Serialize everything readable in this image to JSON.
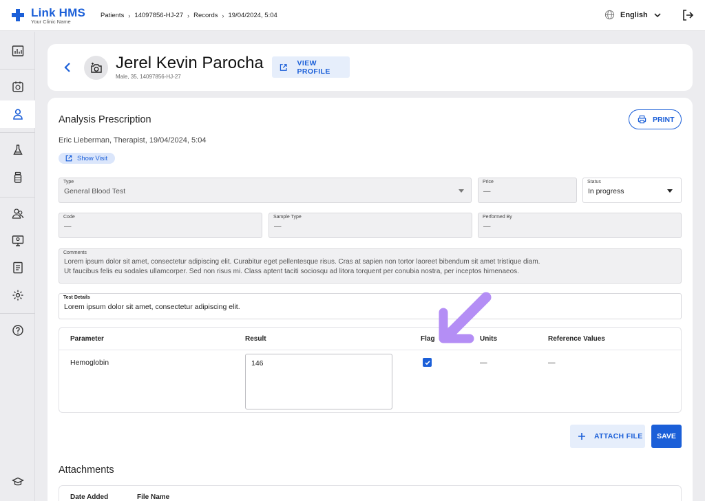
{
  "app": {
    "name": "Link HMS",
    "tagline": "Your Clinic Name",
    "brand_color": "#1b5fd8"
  },
  "breadcrumb": [
    "Patients",
    "14097856-HJ-27",
    "Records",
    "19/04/2024, 5:04"
  ],
  "language": "English",
  "sidebar": {
    "items": [
      {
        "icon": "dashboard-icon",
        "active": false
      },
      {
        "icon": "calendar-icon",
        "active": false
      },
      {
        "icon": "person-icon",
        "active": true
      },
      {
        "icon": "lab-flask-icon",
        "active": false
      },
      {
        "icon": "medicine-bottle-icon",
        "active": false
      },
      {
        "icon": "staff-icon",
        "active": false
      },
      {
        "icon": "monitor-icon",
        "active": false
      },
      {
        "icon": "report-icon",
        "active": false
      },
      {
        "icon": "gear-icon",
        "active": false
      },
      {
        "icon": "help-icon",
        "active": false
      },
      {
        "icon": "graduation-cap-icon",
        "active": false
      }
    ]
  },
  "patient": {
    "name": "Jerel Kevin Parocha",
    "meta": "Male, 35, 14097856-HJ-27",
    "view_profile_label": "VIEW PROFILE"
  },
  "prescription": {
    "title": "Analysis Prescription",
    "print_label": "PRINT",
    "prescriber": "Eric Lieberman, Therapist, 19/04/2024, 5:04",
    "show_visit_label": "Show Visit"
  },
  "fields": {
    "type": {
      "label": "Type",
      "value": "General Blood Test"
    },
    "price": {
      "label": "Price",
      "value": "—"
    },
    "status": {
      "label": "Status",
      "value": "In progress"
    },
    "code": {
      "label": "Code",
      "value": "—"
    },
    "sample_type": {
      "label": "Sample Type",
      "value": "—"
    },
    "performed_by": {
      "label": "Performed By",
      "value": "—"
    },
    "comments": {
      "label": "Comments",
      "line1": "Lorem ipsum dolor sit amet, consectetur adipiscing elit. Curabitur eget pellentesque risus. Cras at sapien non tortor laoreet bibendum sit amet tristique diam.",
      "line2": "Ut faucibus felis eu sodales ullamcorper. Sed non risus mi. Class aptent taciti sociosqu ad litora torquent per conubia nostra, per inceptos himenaeos."
    },
    "test_details": {
      "label": "Test Details",
      "value": "Lorem ipsum dolor sit amet, consectetur adipiscing elit."
    }
  },
  "results_table": {
    "headers": {
      "parameter": "Parameter",
      "result": "Result",
      "flag": "Flag",
      "units": "Units",
      "reference": "Reference Values"
    },
    "rows": [
      {
        "parameter": "Hemoglobin",
        "result": "146",
        "flag": true,
        "units": "—",
        "reference": "—"
      }
    ]
  },
  "actions": {
    "attach_file_label": "ATTACH FILE",
    "save_label": "SAVE"
  },
  "attachments": {
    "title": "Attachments",
    "headers": {
      "date_added": "Date Added",
      "file_name": "File Name"
    }
  },
  "annotation": {
    "color": "#b48ef5"
  }
}
